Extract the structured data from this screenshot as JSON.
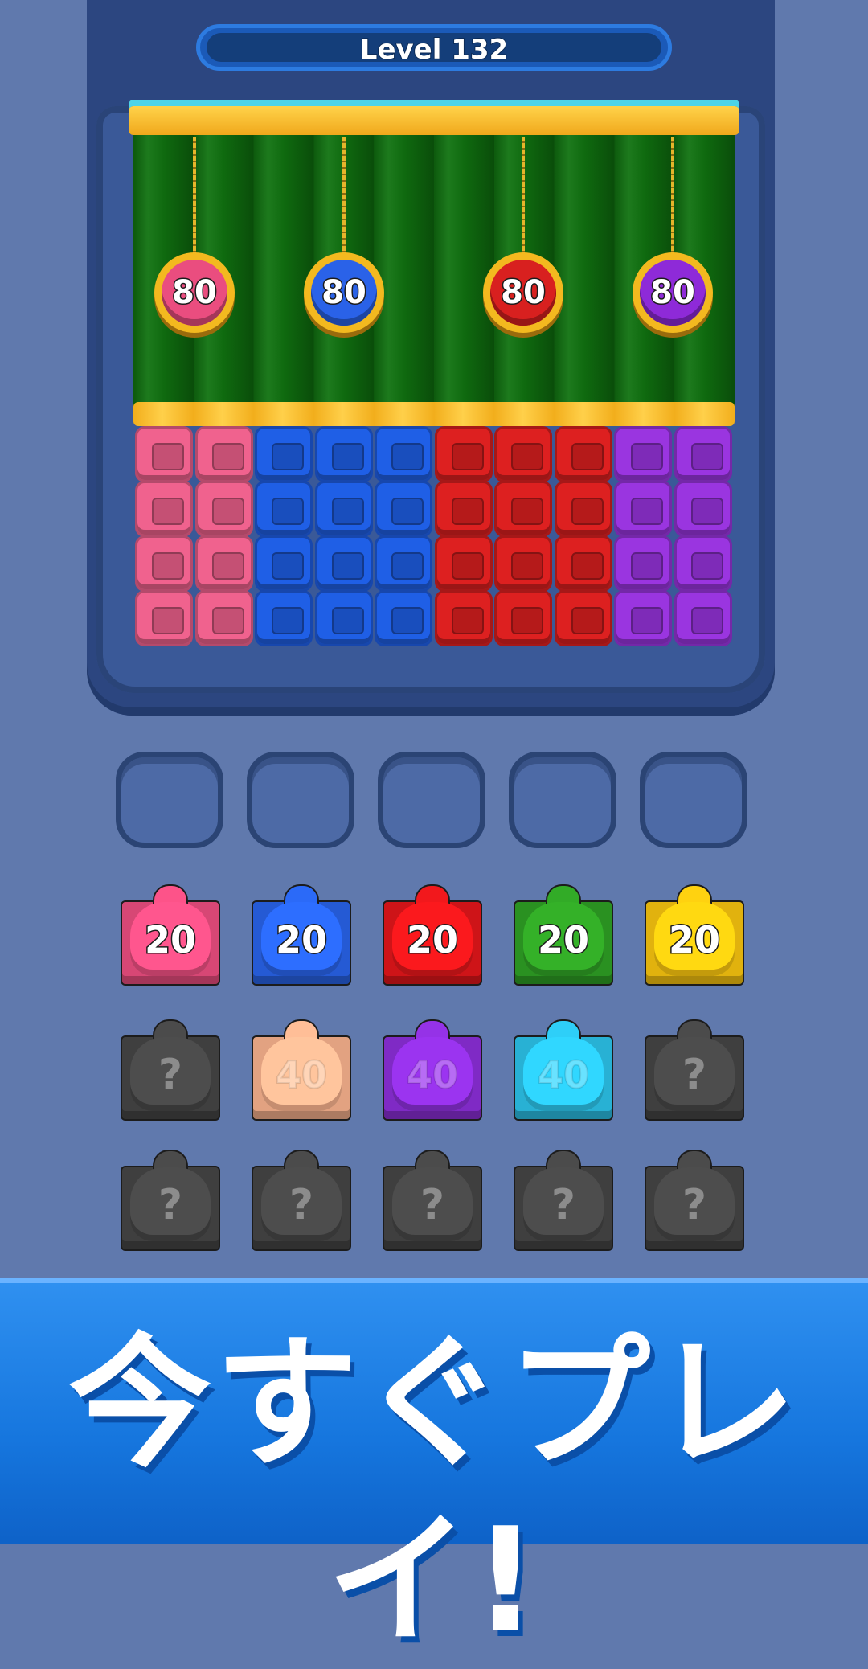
{
  "level": {
    "label": "Level 132"
  },
  "medals": [
    {
      "value": "80",
      "color": "#ea4d7f"
    },
    {
      "value": "80",
      "color": "#2a62e8"
    },
    {
      "value": "80",
      "color": "#d8201f"
    },
    {
      "value": "80",
      "color": "#8e2ad8"
    }
  ],
  "columns": [
    {
      "color": "pink"
    },
    {
      "color": "pink"
    },
    {
      "color": "blue"
    },
    {
      "color": "blue"
    },
    {
      "color": "blue"
    },
    {
      "color": "red"
    },
    {
      "color": "red"
    },
    {
      "color": "red"
    },
    {
      "color": "purple"
    },
    {
      "color": "purple"
    }
  ],
  "slots": {
    "count": 5
  },
  "tank_rows": [
    [
      {
        "label": "20",
        "color": "#ea4d7f",
        "state": "active"
      },
      {
        "label": "20",
        "color": "#2862e6",
        "state": "active"
      },
      {
        "label": "20",
        "color": "#e0161a",
        "state": "active"
      },
      {
        "label": "20",
        "color": "#2e9e24",
        "state": "active"
      },
      {
        "label": "20",
        "color": "#f5c20f",
        "state": "active"
      }
    ],
    [
      {
        "label": "?",
        "color": "#454545",
        "state": "mystery"
      },
      {
        "label": "40",
        "color": "#f6b08c",
        "state": "locked"
      },
      {
        "label": "40",
        "color": "#8a2ed6",
        "state": "locked"
      },
      {
        "label": "40",
        "color": "#2bc0e6",
        "state": "locked"
      },
      {
        "label": "?",
        "color": "#454545",
        "state": "mystery"
      }
    ],
    [
      {
        "label": "?",
        "color": "#454545",
        "state": "mystery"
      },
      {
        "label": "?",
        "color": "#454545",
        "state": "mystery"
      },
      {
        "label": "?",
        "color": "#454545",
        "state": "mystery"
      },
      {
        "label": "?",
        "color": "#454545",
        "state": "mystery"
      },
      {
        "label": "?",
        "color": "#454545",
        "state": "mystery"
      }
    ]
  ],
  "block_colors": {
    "pink": "#f0628e",
    "blue": "#1f5fe6",
    "red": "#dd2020",
    "purple": "#9a35e0"
  },
  "banner": {
    "text": "今すぐプレイ!"
  }
}
